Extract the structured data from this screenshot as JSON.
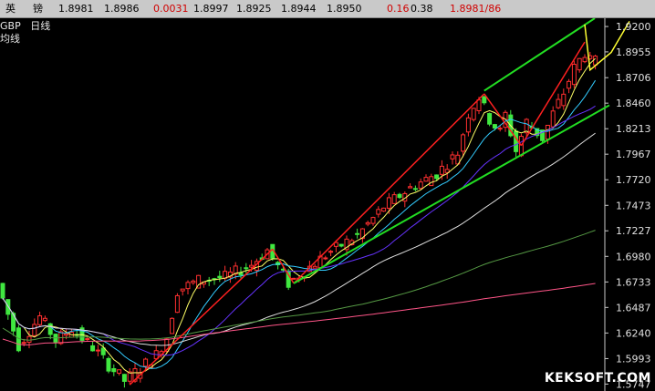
{
  "quote": {
    "name_1": "英",
    "name_2": "镑",
    "last": "1.8981",
    "prev": "1.8986",
    "change": "0.0031",
    "open": "1.8997",
    "low": "1.8925",
    "high": "1.8944",
    "close_alt": "1.8950",
    "change_pct": "0.16",
    "amount": "0.38",
    "bid_ask": "1.8981/86"
  },
  "legend": {
    "symbol": "GBP",
    "period": "日线",
    "indicator": "均线"
  },
  "watermark": "KEKSOFT.COM",
  "colors": {
    "background": "#000000",
    "up_candle": "#ff3030",
    "down_candle": "#40e840",
    "trend_channel": "#22dd22",
    "trend_red": "#ff2020",
    "trend_yellow": "#ffff33"
  },
  "chart_data": {
    "type": "candlestick",
    "y_axis_ticks": [
      "1.9200",
      "1.8955",
      "1.8706",
      "1.8460",
      "1.8213",
      "1.7967",
      "1.7720",
      "1.7473",
      "1.7227",
      "1.6980",
      "1.6733",
      "1.6487",
      "1.6240",
      "1.5993",
      "1.5747"
    ],
    "ylim": [
      1.568,
      1.928
    ],
    "moving_averages": [
      {
        "color": "#ffff66"
      },
      {
        "color": "#33ccff"
      },
      {
        "color": "#6633ff"
      },
      {
        "color": "#dddddd"
      },
      {
        "color": "#559944"
      },
      {
        "color": "#ff5588"
      }
    ]
  }
}
